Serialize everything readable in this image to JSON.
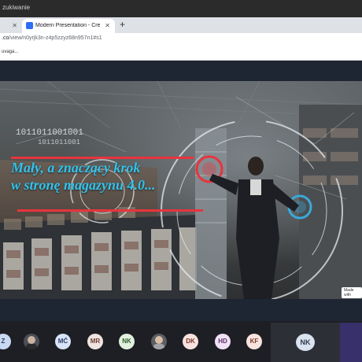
{
  "window": {
    "title_fragment": "zukiwanie"
  },
  "tabs": [
    {
      "label": "",
      "active": false
    },
    {
      "label": "Modern Presentation - Created",
      "active": true
    }
  ],
  "address_bar": {
    "url_prefix": ".co",
    "url_path": "/view/n0yrjk3n-z4p5zzyz68n957n1#s1"
  },
  "bookmarks": {
    "text": "uvaga..."
  },
  "slide": {
    "headline_lines": [
      "Mały, a znaczący krok",
      "w stronę magazynu 4.0..."
    ],
    "binary_text_1": "1011011001001",
    "binary_text_2": "1011011001",
    "accent_color": "#2fc4ee",
    "bar_color": "#e8343d",
    "badge": "Made with"
  },
  "participants": [
    {
      "initials": "Z",
      "kind": "initials",
      "bg": "#c9d8f2",
      "fg": "#2d3e63"
    },
    {
      "initials": "",
      "kind": "photo"
    },
    {
      "initials": "MĆ",
      "kind": "initials",
      "bg": "#d8e4f8",
      "fg": "#2c3e64"
    },
    {
      "initials": "MR",
      "kind": "initials",
      "bg": "#f0e4e0",
      "fg": "#6b3e34"
    },
    {
      "initials": "NK",
      "kind": "initials",
      "bg": "#e0f1dd",
      "fg": "#2f5b2c"
    },
    {
      "initials": "",
      "kind": "photo"
    },
    {
      "initials": "DK",
      "kind": "initials",
      "bg": "#f8e2df",
      "fg": "#7a352c"
    },
    {
      "initials": "HD",
      "kind": "initials",
      "bg": "#f1e0f6",
      "fg": "#5c2f6a"
    },
    {
      "initials": "KF",
      "kind": "initials",
      "bg": "#f8e4de",
      "fg": "#7b3b2b"
    }
  ],
  "active_speaker": {
    "initials": "NK"
  }
}
